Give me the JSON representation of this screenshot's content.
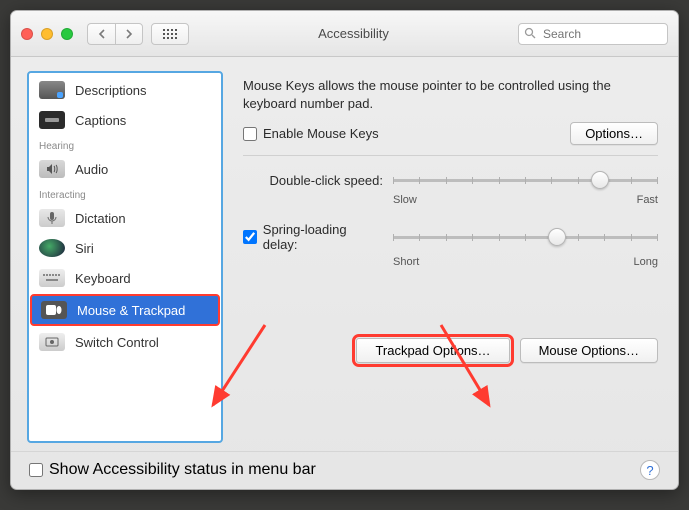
{
  "window": {
    "title": "Accessibility"
  },
  "toolbar": {
    "search_placeholder": "Search"
  },
  "sidebar": {
    "cat_hearing": "Hearing",
    "cat_interacting": "Interacting",
    "items": {
      "descriptions": "Descriptions",
      "captions": "Captions",
      "audio": "Audio",
      "dictation": "Dictation",
      "siri": "Siri",
      "keyboard": "Keyboard",
      "mouse_trackpad": "Mouse & Trackpad",
      "switch_control": "Switch Control"
    }
  },
  "main": {
    "description": "Mouse Keys allows the mouse pointer to be controlled using the keyboard number pad.",
    "enable_mouse_keys": "Enable Mouse Keys",
    "options_btn": "Options…",
    "double_click_label": "Double-click speed:",
    "double_click_min": "Slow",
    "double_click_max": "Fast",
    "spring_label": "Spring-loading delay:",
    "spring_min": "Short",
    "spring_max": "Long",
    "trackpad_options_btn": "Trackpad Options…",
    "mouse_options_btn": "Mouse Options…"
  },
  "footer": {
    "show_status": "Show Accessibility status in menu bar"
  },
  "state": {
    "enable_mouse_keys_checked": false,
    "spring_loading_checked": true,
    "double_click_value_pct": 78,
    "spring_delay_value_pct": 62,
    "show_status_checked": false
  }
}
